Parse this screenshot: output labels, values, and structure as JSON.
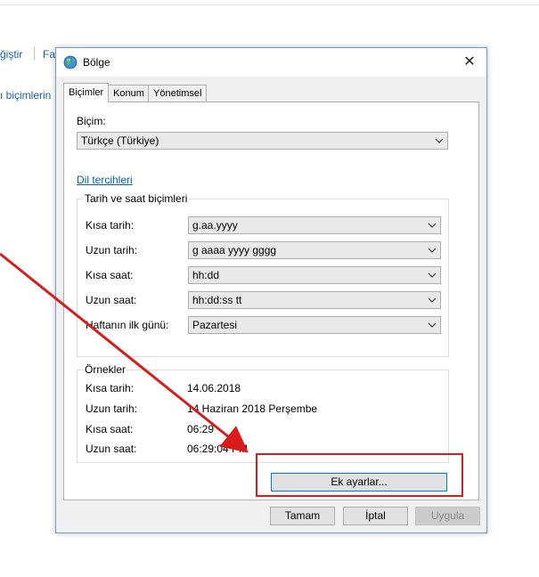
{
  "background": {
    "link1": "ğiştir",
    "link2": "Fa",
    "link3": "ı biçimlerin"
  },
  "dialog": {
    "title": "Bölge",
    "close_glyph": "✕",
    "tabs": [
      "Biçimler",
      "Konum",
      "Yönetimsel"
    ],
    "format_label": "Biçim:",
    "format_value": "Türkçe (Türkiye)",
    "language_link": "Dil tercihleri",
    "datetime_group": {
      "title": "Tarih ve saat biçimleri",
      "rows": [
        {
          "label": "Kısa tarih:",
          "value": "g.aa.yyyy"
        },
        {
          "label": "Uzun tarih:",
          "value": "g aaaa yyyy gggg"
        },
        {
          "label": "Kısa saat:",
          "value": "hh:dd"
        },
        {
          "label": "Uzun saat:",
          "value": "hh:dd:ss tt"
        },
        {
          "label": "Haftanın ilk günü:",
          "value": "Pazartesi"
        }
      ]
    },
    "examples_group": {
      "title": "Örnekler",
      "rows": [
        {
          "label": "Kısa tarih:",
          "value": "14.06.2018"
        },
        {
          "label": "Uzun tarih:",
          "value": "14 Haziran 2018 Perşembe"
        },
        {
          "label": "Kısa saat:",
          "value": "06:29"
        },
        {
          "label": "Uzun saat:",
          "value": "06:29:04 PM"
        }
      ]
    },
    "additional_settings": "Ek ayarlar...",
    "buttons": {
      "ok": "Tamam",
      "cancel": "İptal",
      "apply": "Uygula"
    }
  },
  "colors": {
    "annotation": "#d81c1c",
    "link": "#0063b1",
    "accent": "#0078d7"
  }
}
